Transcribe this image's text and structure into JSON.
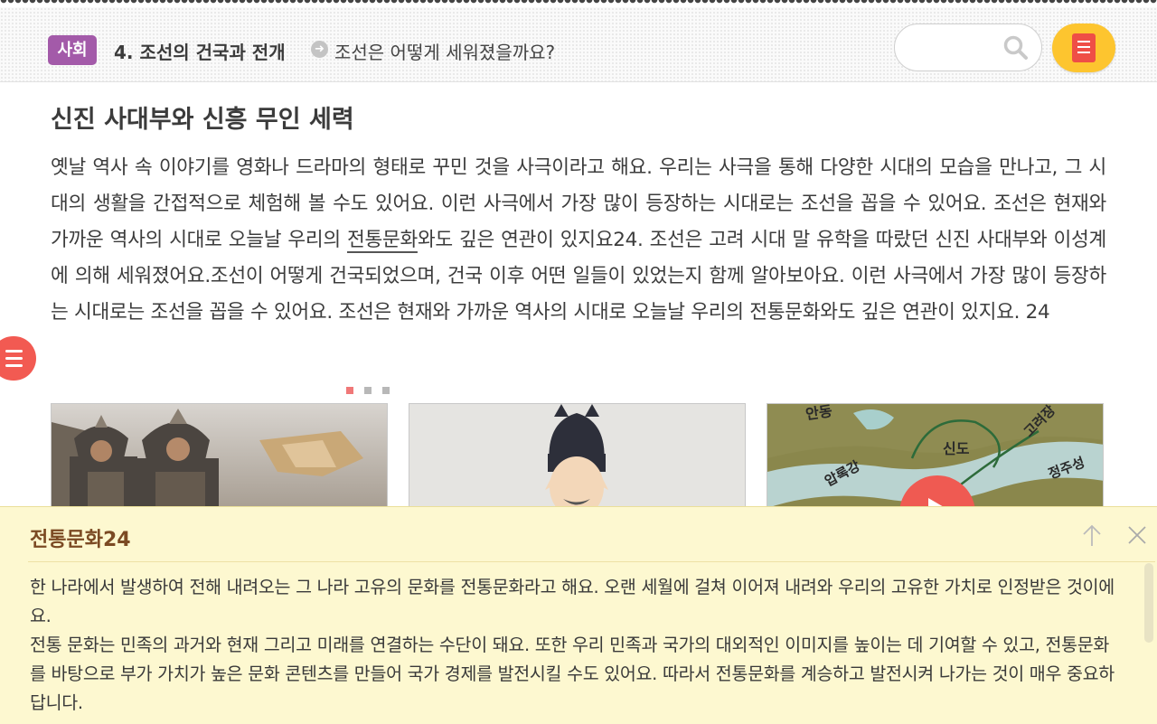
{
  "header": {
    "subject_badge": "사회",
    "chapter_title": "4. 조선의 건국과 전개",
    "lesson_question": "조선은 어떻게 세워졌을까요?",
    "search": {
      "value": "",
      "placeholder": ""
    },
    "notes_icon": "notebook-icon"
  },
  "main": {
    "section_title": "신진 사대부와 신흥 무인 세력",
    "paragraph": {
      "part1": "옛날 역사 속 이야기를 영화나 드라마의 형태로 꾸민 것을 사극이라고 해요. 우리는 사극을 통해 다양한 시대의 모습을 만나고, 그 시대의 생활을 간접적으로 체험해 볼 수도 있어요. 이런 사극에서 가장 많이 등장하는 시대로는 조선을 꼽을 수 있어요. 조선은 현재와 가까운 역사의 시대로 오늘날 우리의 ",
      "term": "전통문화",
      "part2": "와도 깊은 연관이 있지요24. 조선은 고려 시대 말 유학을 따랐던 신진 사대부와 이성계에 의해 세워졌어요.조선이 어떻게 건국되었으며, 건국 이후 어떤 일들이 있었는지 함께 알아보아요. 이런 사극에서 가장 많이 등장하는 시대로는 조선을 꼽을 수 있어요. 조선은 현재와 가까운 역사의 시대로 오늘날 우리의 전통문화와도 깊은 연관이 있지요. 24"
    },
    "carousel": {
      "active_index": 0,
      "count": 3
    },
    "map_labels": [
      "안동",
      "신도",
      "압록강",
      "고려장",
      "정주성"
    ]
  },
  "colors": {
    "badge": "#a35aa9",
    "accent_red": "#f25a52",
    "notes_button": "#fdc52f",
    "popup_bg": "#fdf8d0",
    "popup_title": "#7b4a23"
  },
  "popup": {
    "title": "전통문화24",
    "p1": "한 나라에서 발생하여 전해 내려오는 그 나라 고유의 문화를 전통문화라고 해요. 오랜 세월에 걸쳐 이어져 내려와 우리의 고유한 가치로 인정받은 것이에요.",
    "p2": "전통 문화는 민족의 과거와 현재 그리고 미래를 연결하는 수단이 돼요. 또한 우리 민족과 국가의 대외적인 이미지를 높이는 데 기여할 수 있고, 전통문화를 바탕으로 부가 가치가 높은 문화 콘텐츠를 만들어 국가 경제를 발전시킬 수도 있어요. 따라서 전통문화를 계승하고 발전시켜 나가는 것이 매우 중요하답니다."
  }
}
